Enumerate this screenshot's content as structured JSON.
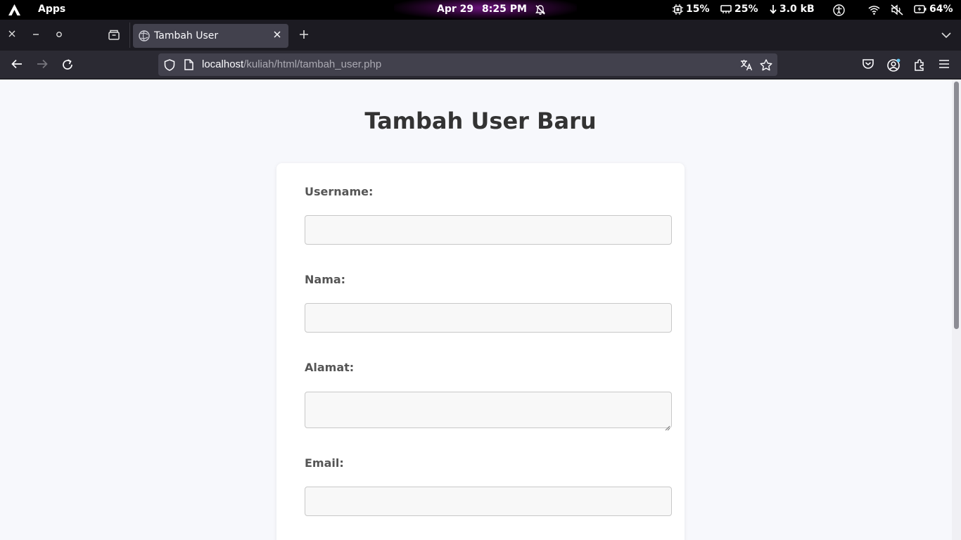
{
  "system_bar": {
    "launcher": "Apps",
    "date": "Apr 29",
    "time": "8:25 PM",
    "cpu": "15%",
    "memory": "25%",
    "network": "3.0 kB",
    "battery": "64%"
  },
  "tab": {
    "title": "Tambah User"
  },
  "url": {
    "host": "localhost",
    "path": "/kuliah/html/tambah_user.php"
  },
  "page": {
    "heading": "Tambah User Baru",
    "form": {
      "username_label": "Username:",
      "username_value": "",
      "nama_label": "Nama:",
      "nama_value": "",
      "alamat_label": "Alamat:",
      "alamat_value": "",
      "email_label": "Email:",
      "email_value": ""
    }
  }
}
